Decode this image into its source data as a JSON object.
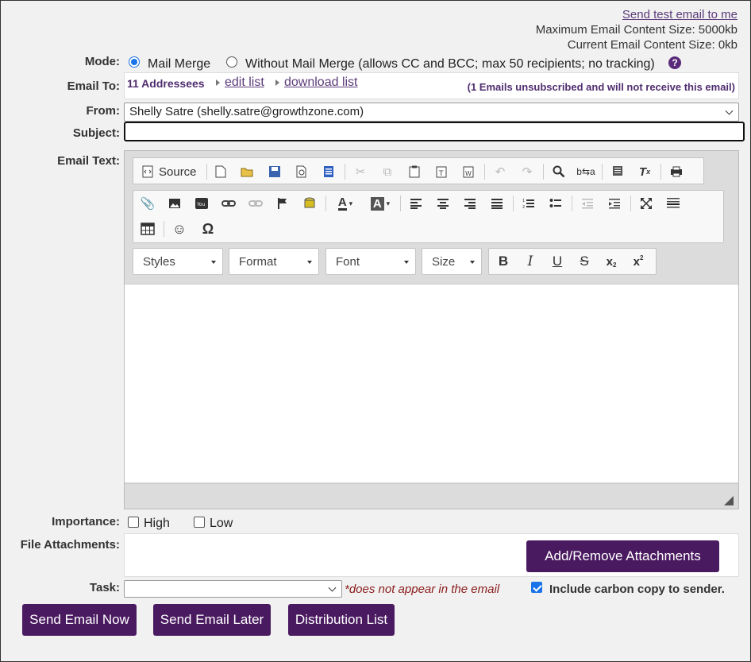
{
  "top": {
    "test_link": "Send test email to me",
    "max_size": "Maximum Email Content Size: 5000kb",
    "current_size": "Current Email Content Size: 0kb"
  },
  "mode": {
    "label": "Mode:",
    "option_merge": "Mail Merge",
    "option_no_merge": "Without Mail Merge (allows CC and BCC; max 50 recipients; no tracking)",
    "selected": "Mail Merge",
    "help_icon": "?"
  },
  "email_to": {
    "label": "Email To:",
    "addressees": "11 Addressees",
    "edit_link": "edit list",
    "download_link": "download list",
    "unsubscribed_note": "(1 Emails unsubscribed and will not receive this email)"
  },
  "from": {
    "label": "From:",
    "value": "Shelly Satre (shelly.satre@growthzone.com)"
  },
  "subject": {
    "label": "Subject:",
    "value": ""
  },
  "email_text": {
    "label": "Email Text:",
    "source_label": "Source",
    "combos": [
      "Styles",
      "Format",
      "Font",
      "Size"
    ]
  },
  "importance": {
    "label": "Importance:",
    "high": "High",
    "low": "Low"
  },
  "attachments": {
    "label": "File Attachments:",
    "button": "Add/Remove Attachments"
  },
  "task": {
    "label": "Task:",
    "value": "",
    "note": "*does not appear in the email",
    "carbon_copy": "Include carbon copy to sender.",
    "carbon_copy_checked": true
  },
  "actions": {
    "send_now": "Send Email Now",
    "send_later": "Send Email Later",
    "distribution": "Distribution List"
  },
  "colors": {
    "accent": "#4a1a60",
    "link": "#5b3b7a",
    "note": "#8b1c1c"
  }
}
